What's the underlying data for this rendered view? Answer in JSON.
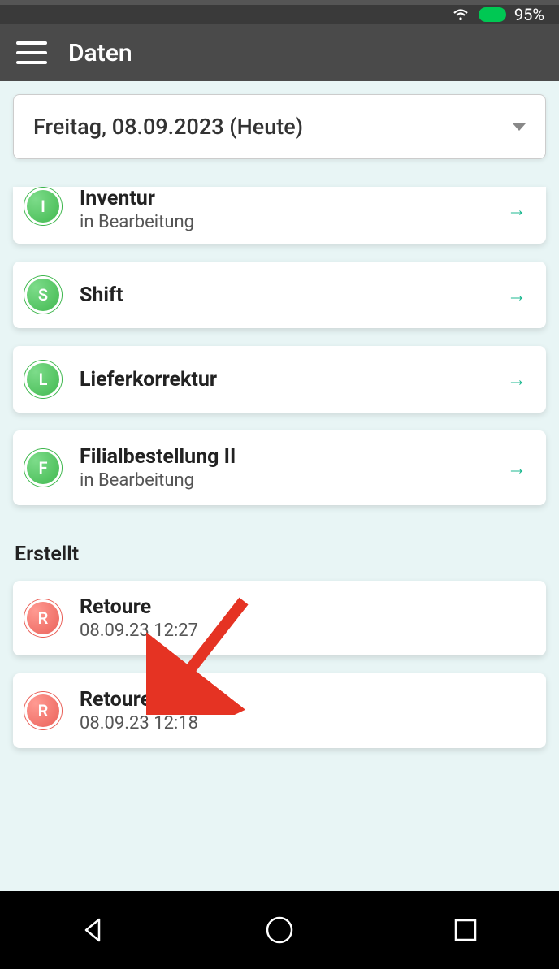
{
  "status": {
    "battery_pct": "95%"
  },
  "header": {
    "title": "Daten"
  },
  "date_selector": {
    "label": "Freitag, 08.09.2023 (Heute)"
  },
  "tasks": [
    {
      "badge": "I",
      "title": "Inventur",
      "subtitle": "in Bearbeitung",
      "color": "green",
      "clipped": true
    },
    {
      "badge": "S",
      "title": "Shift",
      "subtitle": "",
      "color": "green"
    },
    {
      "badge": "L",
      "title": "Lieferkorrektur",
      "subtitle": "",
      "color": "green"
    },
    {
      "badge": "F",
      "title": "Filialbestellung II",
      "subtitle": "in Bearbeitung",
      "color": "green"
    }
  ],
  "created_section": {
    "label": "Erstellt",
    "items": [
      {
        "badge": "R",
        "title": "Retoure",
        "subtitle": "08.09.23 12:27",
        "color": "red"
      },
      {
        "badge": "R",
        "title": "Retoure",
        "subtitle": "08.09.23 12:18",
        "color": "red"
      }
    ]
  }
}
